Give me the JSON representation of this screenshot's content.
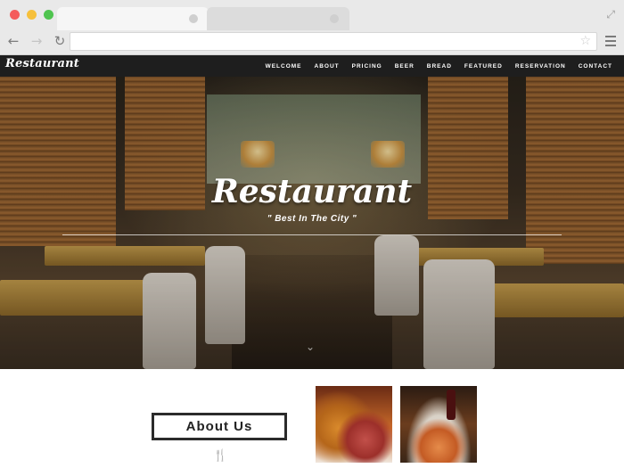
{
  "browser": {
    "back_icon": "←",
    "forward_icon": "→",
    "reload_icon": "↻",
    "star_icon": "☆",
    "resize_icon": "⤢"
  },
  "site": {
    "logo": "Restaurant",
    "menu": [
      "WELCOME",
      "ABOUT",
      "PRICING",
      "BEER",
      "BREAD",
      "FEATURED",
      "RESERVATION",
      "CONTACT"
    ]
  },
  "hero": {
    "title": "Restaurant",
    "subtitle": "\" Best In The City \"",
    "scroll_icon": "⌄"
  },
  "about": {
    "heading": "About Us",
    "cutlery_icon": "🍴"
  },
  "colors": {
    "nav_bg": "#1e1e1e",
    "chrome_bg": "#e9e9e9",
    "accent_text": "#ffffff"
  }
}
